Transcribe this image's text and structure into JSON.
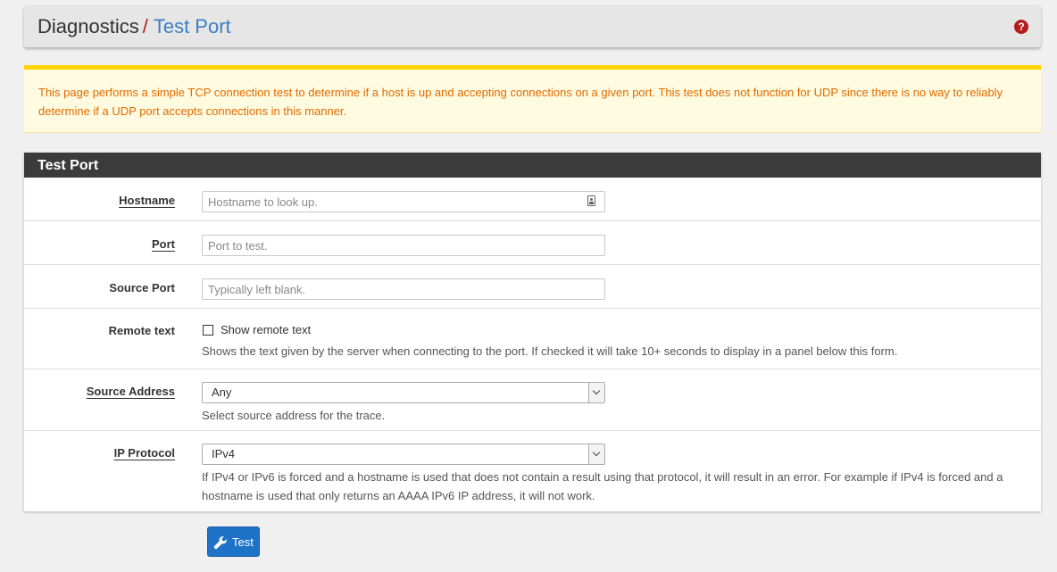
{
  "header": {
    "breadcrumb_root": "Diagnostics",
    "separator": "/",
    "breadcrumb_current": "Test Port",
    "help_icon": "question-circle-icon",
    "help_glyph": "?"
  },
  "alert": {
    "text": "This page performs a simple TCP connection test to determine if a host is up and accepting connections on a given port. This test does not function for UDP since there is no way to reliably determine if a UDP port accepts connections in this manner."
  },
  "panel": {
    "title": "Test Port",
    "hostname": {
      "label": "Hostname",
      "placeholder": "Hostname to look up.",
      "value": ""
    },
    "port": {
      "label": "Port",
      "placeholder": "Port to test.",
      "value": ""
    },
    "source_port": {
      "label": "Source Port",
      "placeholder": "Typically left blank.",
      "value": ""
    },
    "remote_text": {
      "label": "Remote text",
      "checkbox_label": "Show remote text",
      "checked": false,
      "help": "Shows the text given by the server when connecting to the port. If checked it will take 10+ seconds to display in a panel below this form."
    },
    "source_address": {
      "label": "Source Address",
      "selected": "Any",
      "help": "Select source address for the trace."
    },
    "ip_protocol": {
      "label": "IP Protocol",
      "selected": "IPv4",
      "help": "If IPv4 or IPv6 is forced and a hostname is used that does not contain a result using that protocol, it will result in an error. For example if IPv4 is forced and a hostname is used that only returns an AAAA IPv6 IP address, it will not work."
    }
  },
  "actions": {
    "test_label": "Test",
    "test_icon": "wrench-icon"
  },
  "colors": {
    "accent_blue": "#3c7fc4",
    "button_blue": "#1e73c8",
    "alert_text": "#e26a00",
    "alert_border": "#ffd200",
    "panel_heading": "#3b3b3b",
    "help_red": "#b71c1c"
  }
}
